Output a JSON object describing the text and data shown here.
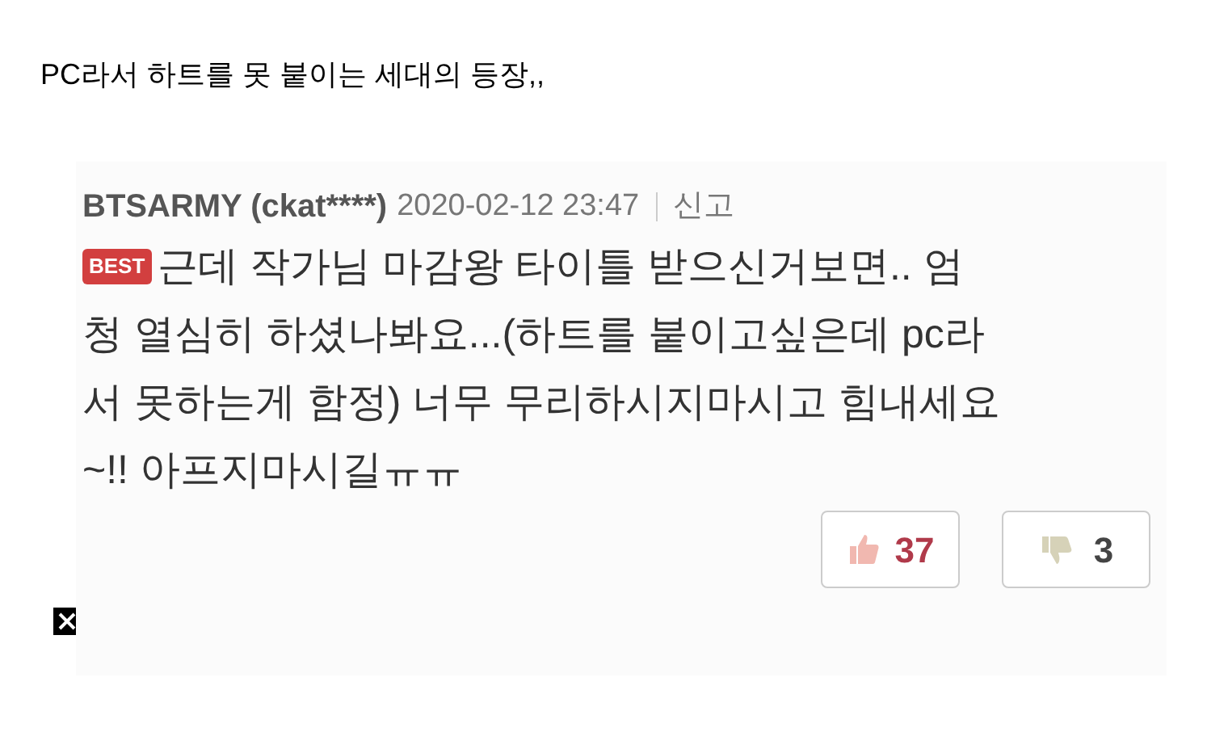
{
  "post_title": "PC라서 하트를 못 붙이는 세대의 등장,,",
  "comment": {
    "author": "BTSARMY (ckat****)",
    "date": "2020-02-12 23:47",
    "report": "신고",
    "badge": "BEST",
    "text_lines": [
      "근데 작가님 마감왕 타이틀 받으신거보면.. 엄",
      "청 열심히 하셨나봐요...(하트를 붙이고싶은데 pc라",
      "서 못하는게 함정) 너무 무리하시지마시고 힘내세요",
      "~!! 아프지마시길ㅠㅠ"
    ],
    "likes": "37",
    "dislikes": "3"
  }
}
